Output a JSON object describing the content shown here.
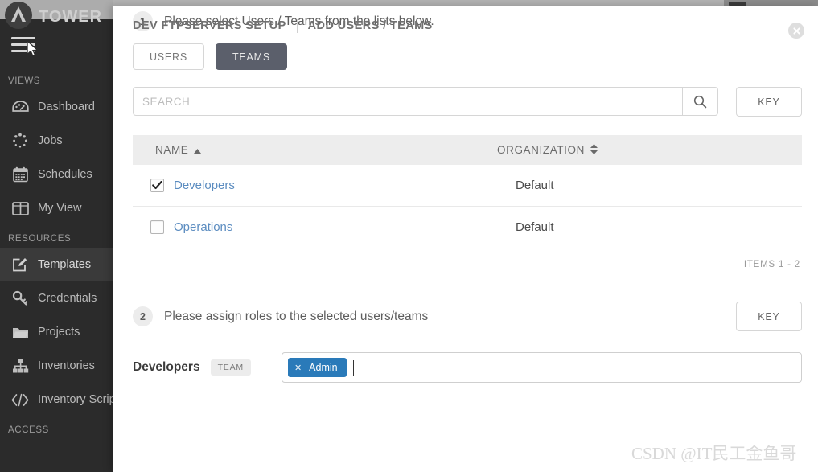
{
  "app": {
    "brand": "TOWER",
    "logo_icon": "ansible-logo-icon",
    "menu_icon": "hamburger-menu-icon",
    "cursor_icon": "mouse-cursor-icon"
  },
  "sidebar": {
    "sections": [
      {
        "label": "VIEWS",
        "items": [
          {
            "label": "Dashboard",
            "icon": "dashboard-gauge-icon",
            "active": false
          },
          {
            "label": "Jobs",
            "icon": "jobs-spinner-icon",
            "active": false
          },
          {
            "label": "Schedules",
            "icon": "calendar-icon",
            "active": false
          },
          {
            "label": "My View",
            "icon": "my-view-panels-icon",
            "active": false
          }
        ]
      },
      {
        "label": "RESOURCES",
        "items": [
          {
            "label": "Templates",
            "icon": "templates-pencil-icon",
            "active": true
          },
          {
            "label": "Credentials",
            "icon": "key-icon",
            "active": false
          },
          {
            "label": "Projects",
            "icon": "folder-icon",
            "active": false
          },
          {
            "label": "Inventories",
            "icon": "inventories-sitemap-icon",
            "active": false
          },
          {
            "label": "Inventory Scripts",
            "icon": "code-brackets-icon",
            "active": false
          }
        ]
      },
      {
        "label": "ACCESS",
        "items": []
      }
    ]
  },
  "modal": {
    "title_primary": "DEV FTPSERVERS SETUP",
    "title_secondary": "ADD USERS / TEAMS",
    "close_icon": "close-x-icon",
    "step1": {
      "number": "1",
      "text": "Please select Users / Teams from the lists below.",
      "toggles": [
        {
          "label": "USERS",
          "selected": false
        },
        {
          "label": "TEAMS",
          "selected": true
        }
      ],
      "search": {
        "value": "",
        "placeholder": "SEARCH",
        "icon": "search-magnifier-icon"
      },
      "key_button": "KEY",
      "table": {
        "columns": [
          {
            "label": "NAME",
            "sort": "asc",
            "sort_icon": "sort-ascending-icon"
          },
          {
            "label": "ORGANIZATION",
            "sort": "none",
            "sort_icon": "sort-both-icon"
          }
        ],
        "rows": [
          {
            "checked": true,
            "name": "Developers",
            "organization": "Default"
          },
          {
            "checked": false,
            "name": "Operations",
            "organization": "Default"
          }
        ],
        "items_count": "ITEMS 1 - 2"
      }
    },
    "step2": {
      "number": "2",
      "text": "Please assign roles to the selected users/teams",
      "key_button": "KEY",
      "assignments": [
        {
          "name": "Developers",
          "tag": "TEAM",
          "chips": [
            {
              "label": "Admin",
              "remove_icon": "chip-remove-x-icon"
            }
          ]
        }
      ]
    }
  },
  "watermark": "CSDN @IT民工金鱼哥",
  "colors": {
    "sidebar_bg": "#2b2b2b",
    "sidebar_active": "#3a3a3a",
    "toggle_on": "#5b5f6b",
    "link": "#5b8cc0",
    "chip": "#2a7ab9",
    "table_header": "#ededed"
  }
}
